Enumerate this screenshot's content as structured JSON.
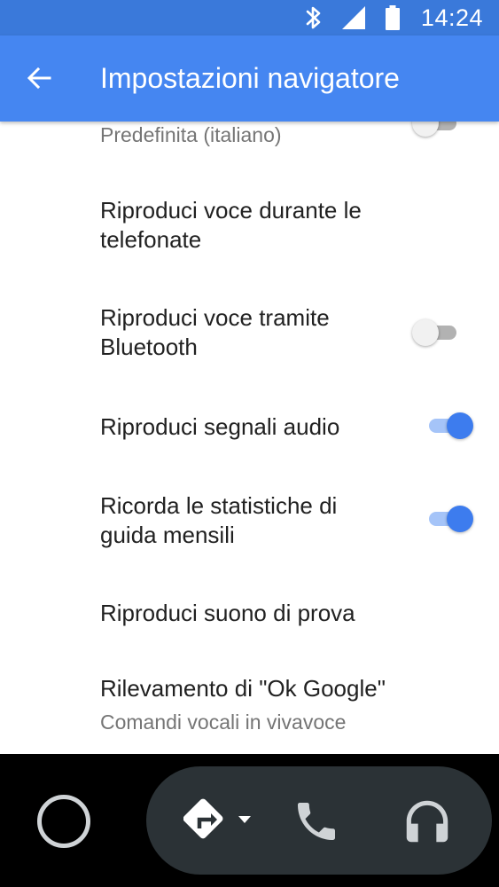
{
  "status_bar": {
    "time": "14:24",
    "icons": [
      "bluetooth-icon",
      "signal-icon",
      "battery-icon"
    ]
  },
  "app_bar": {
    "title": "Impostazioni navigatore",
    "back_icon": "arrow-back-icon"
  },
  "list": {
    "partial_subtitle": "Predefinita (italiano)",
    "items": [
      {
        "title": "Riproduci voce durante le telefonate",
        "toggle": false
      },
      {
        "title": "Riproduci voce tramite Bluetooth",
        "toggle": false
      },
      {
        "title": "Riproduci segnali audio",
        "toggle": true
      },
      {
        "title": "Ricorda le statistiche di guida mensili",
        "toggle": true
      },
      {
        "title": "Riproduci suono di prova"
      },
      {
        "title": "Rilevamento di \"Ok Google\"",
        "subtitle": "Comandi vocali in vivavoce"
      }
    ]
  },
  "bottom_nav": {
    "icons": [
      "home-circle-icon",
      "navigation-icon",
      "phone-icon",
      "headphones-icon"
    ]
  },
  "colors": {
    "status_bar": "#3a79da",
    "app_bar": "#4586f1",
    "accent": "#3d7cee",
    "bottom_bar": "#000000",
    "pill": "#2b3236"
  }
}
